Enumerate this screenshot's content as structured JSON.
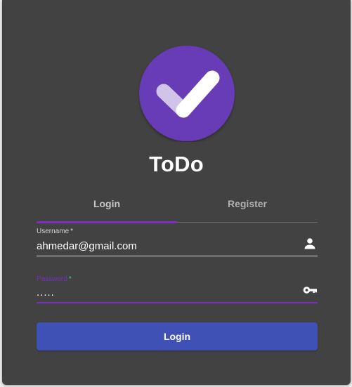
{
  "app": {
    "title": "ToDo",
    "logo_icon": "checkmark-icon",
    "logo_color": "#673ab7"
  },
  "tabs": [
    {
      "label": "Login",
      "active": true
    },
    {
      "label": "Register",
      "active": false
    }
  ],
  "form": {
    "username": {
      "label": "Username",
      "required_mark": "*",
      "value": "ahmedar@gmail.com",
      "icon": "person-icon"
    },
    "password": {
      "label": "Password",
      "required_mark": "*",
      "value": ".....",
      "icon": "key-icon"
    },
    "submit_label": "Login"
  },
  "colors": {
    "card_background": "#424242",
    "accent": "#7b2fbf",
    "button": "#3f51b5",
    "required_star_password": "#39d98a"
  }
}
